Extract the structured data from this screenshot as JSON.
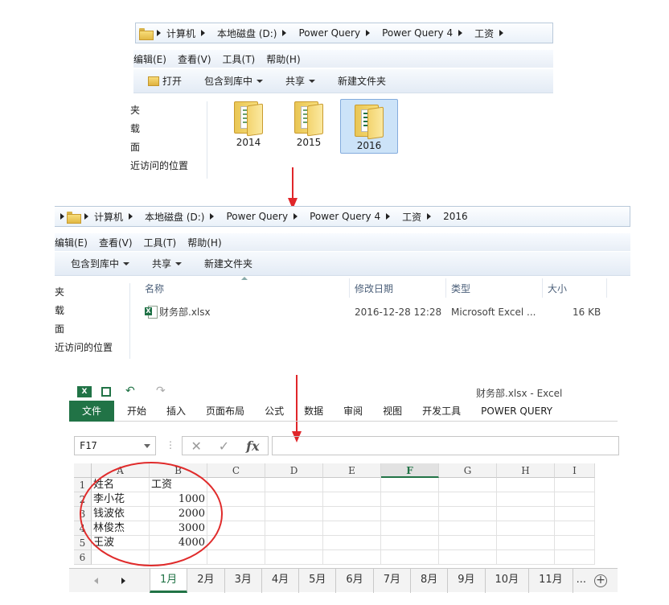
{
  "explorer1": {
    "breadcrumb": [
      "计算机",
      "本地磁盘 (D:)",
      "Power Query",
      "Power Query 4",
      "工资"
    ],
    "menu": [
      "编辑(E)",
      "查看(V)",
      "工具(T)",
      "帮助(H)"
    ],
    "toolbar": {
      "open": "打开",
      "include": "包含到库中",
      "share": "共享",
      "new_folder": "新建文件夹"
    },
    "nav": [
      "夹",
      "载",
      "面",
      "近访问的位置"
    ],
    "folders": [
      {
        "name": "2014"
      },
      {
        "name": "2015"
      },
      {
        "name": "2016",
        "selected": true
      }
    ]
  },
  "explorer2": {
    "breadcrumb": [
      "计算机",
      "本地磁盘 (D:)",
      "Power Query",
      "Power Query 4",
      "工资",
      "2016"
    ],
    "menu": [
      "编辑(E)",
      "查看(V)",
      "工具(T)",
      "帮助(H)"
    ],
    "toolbar": {
      "include": "包含到库中",
      "share": "共享",
      "new_folder": "新建文件夹"
    },
    "nav": [
      "夹",
      "载",
      "面",
      "近访问的位置"
    ],
    "columns": {
      "name": "名称",
      "modified": "修改日期",
      "type": "类型",
      "size": "大小"
    },
    "file": {
      "name": "财务部.xlsx",
      "modified": "2016-12-28 12:28",
      "type": "Microsoft Excel ...",
      "size": "16 KB"
    }
  },
  "excel": {
    "title": "财务部.xlsx - Excel",
    "file_tab": "文件",
    "tabs": [
      "开始",
      "插入",
      "页面布局",
      "公式",
      "数据",
      "审阅",
      "视图",
      "开发工具",
      "POWER QUERY"
    ],
    "name_box": "F17",
    "fx_symbols": {
      "cancel": "✕",
      "enter": "✓",
      "fx": "fx"
    },
    "columns": [
      "A",
      "B",
      "C",
      "D",
      "E",
      "F",
      "G",
      "H",
      "I"
    ],
    "active_column": "F",
    "rows": [
      "1",
      "2",
      "3",
      "4",
      "5",
      "6"
    ],
    "cells": [
      [
        "姓名",
        "工资"
      ],
      [
        "李小花",
        "1000"
      ],
      [
        "钱波依",
        "2000"
      ],
      [
        "林俊杰",
        "3000"
      ],
      [
        "王波",
        "4000"
      ],
      [
        "",
        ""
      ]
    ],
    "sheets": [
      "1月",
      "2月",
      "3月",
      "4月",
      "5月",
      "6月",
      "7月",
      "8月",
      "9月",
      "10月",
      "11月",
      "..."
    ],
    "active_sheet": "1月",
    "add_sheet": "+"
  },
  "colors": {
    "excel_green": "#217346",
    "arrow_red": "#e0262a",
    "circle_red": "#e02b2b",
    "selection": "#cce3f8"
  }
}
